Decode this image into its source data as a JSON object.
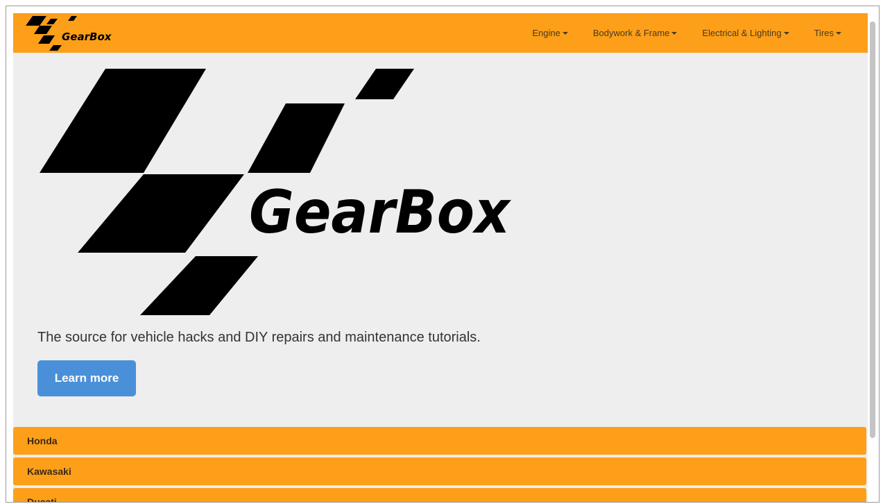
{
  "brand": {
    "name": "GearBox",
    "logo_color": "#000000"
  },
  "navbar": {
    "background": "#fd9f19",
    "items": [
      {
        "label": "Engine"
      },
      {
        "label": "Bodywork & Frame"
      },
      {
        "label": "Electrical & Lighting"
      },
      {
        "label": "Tires"
      }
    ]
  },
  "hero": {
    "tagline": "The source for vehicle hacks and DIY repairs and maintenance tutorials.",
    "button_label": "Learn more",
    "button_color": "#4a90d9"
  },
  "brand_list": {
    "items": [
      {
        "label": "Honda"
      },
      {
        "label": "Kawasaki"
      },
      {
        "label": "Ducati"
      }
    ]
  }
}
